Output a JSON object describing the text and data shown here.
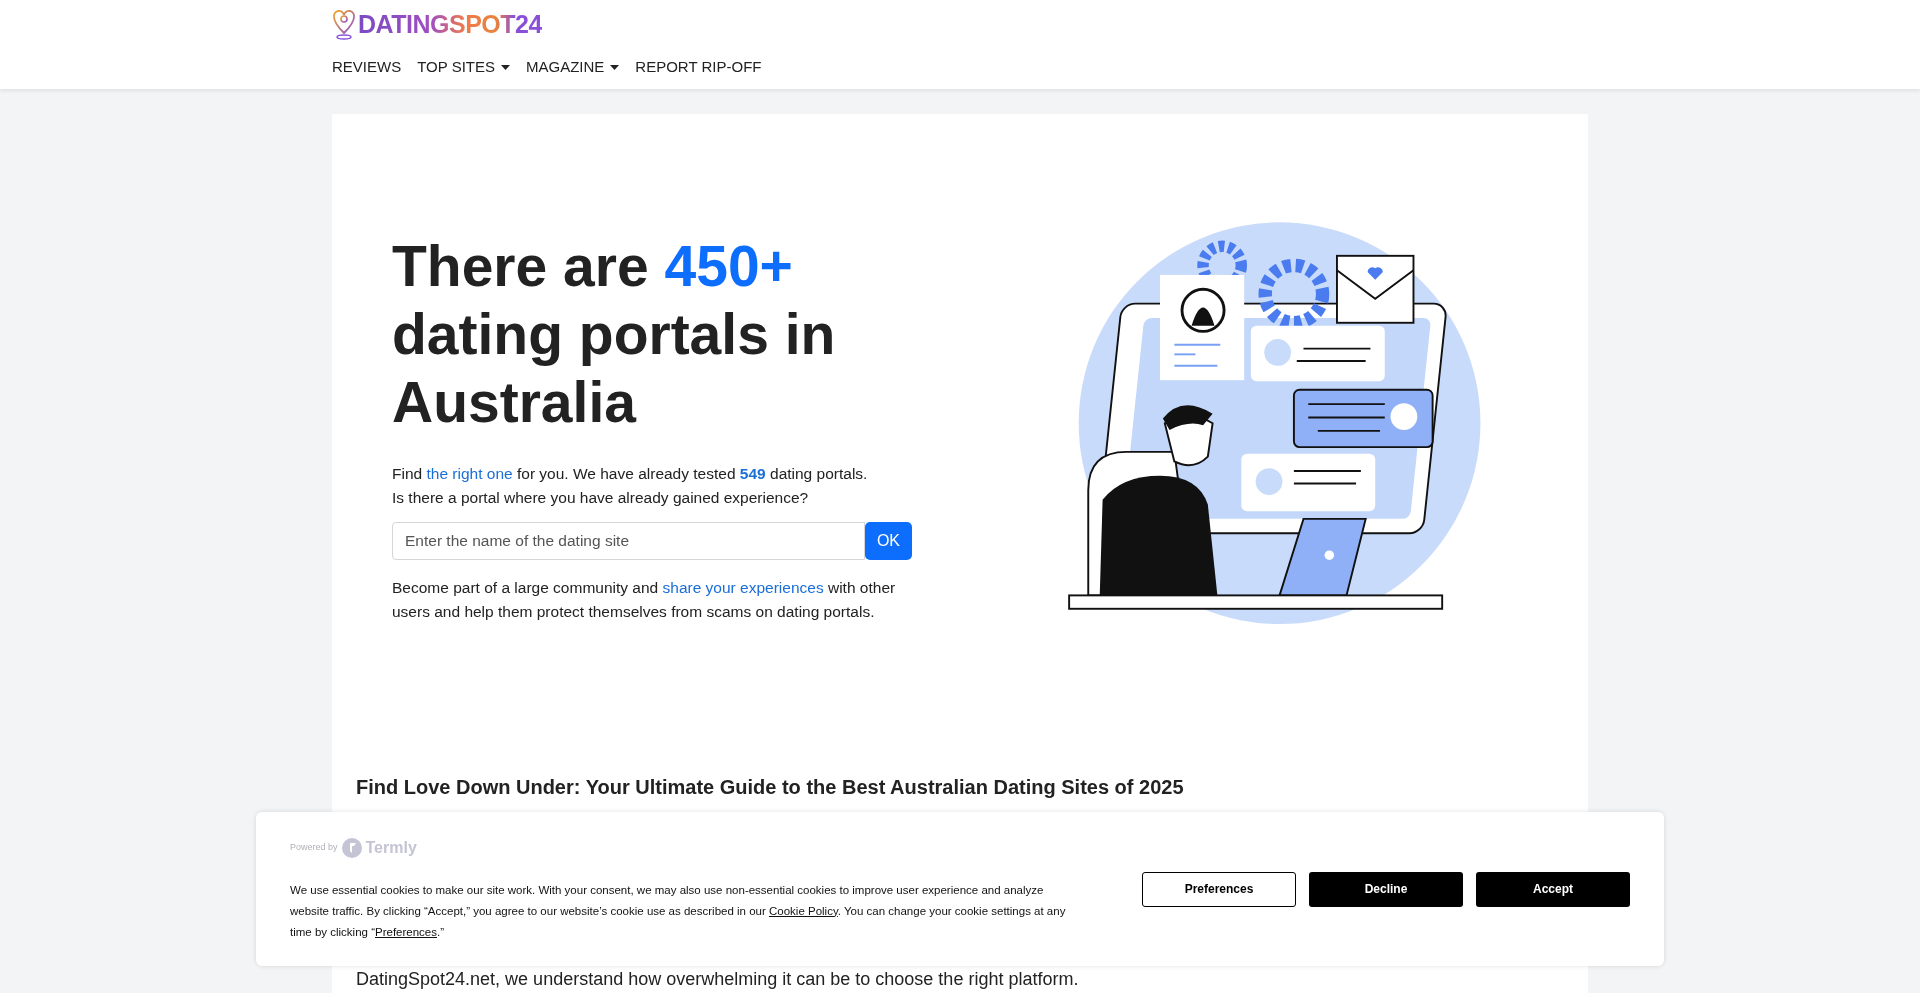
{
  "logo": {
    "text": "DATINGSPOT24"
  },
  "nav": [
    {
      "label": "REVIEWS",
      "has_dropdown": false
    },
    {
      "label": "TOP SITES",
      "has_dropdown": true
    },
    {
      "label": "MAGAZINE",
      "has_dropdown": true
    },
    {
      "label": "REPORT RIP-OFF",
      "has_dropdown": false
    }
  ],
  "hero": {
    "heading": [
      {
        "text": "There are ",
        "kind": "plain"
      },
      {
        "text": "450+",
        "kind": "highlight"
      },
      {
        "text": " dating portals in Australia",
        "kind": "plain"
      }
    ],
    "intro": [
      {
        "text": "Find ",
        "kind": "plain"
      },
      {
        "text": "the right one",
        "kind": "link"
      },
      {
        "text": " for you. We have already tested ",
        "kind": "plain"
      },
      {
        "text": "549",
        "kind": "bold"
      },
      {
        "text": " dating portals.",
        "kind": "plain"
      }
    ],
    "question": "Is there a portal where you have already gained experience?",
    "search": {
      "placeholder": "Enter the name of the dating site",
      "button": "OK"
    },
    "community": [
      {
        "text": "Become part of a large community and ",
        "kind": "plain"
      },
      {
        "text": "share your experiences",
        "kind": "link"
      },
      {
        "text": " with other users and help them protect themselves from scams on dating portals.",
        "kind": "plain"
      }
    ]
  },
  "section": {
    "heading": "Find Love Down Under: Your Ultimate Guide to the Best Australian Dating Sites of 2025",
    "text": "DatingSpot24.net, we understand how overwhelming it can be to choose the right platform."
  },
  "cookie_banner": {
    "powered_by": "Powered by",
    "brand": "Termly",
    "text": [
      {
        "text": "We use essential cookies to make our site work. With your consent, we may also use non-essential cookies to improve user experience and analyze website traffic. By clicking “Accept,” you agree to our website’s cookie use as described in our ",
        "kind": "plain"
      },
      {
        "text": "Cookie Policy",
        "kind": "link"
      },
      {
        "text": ". You can change your cookie settings at any time by clicking “",
        "kind": "plain"
      },
      {
        "text": "Preferences",
        "kind": "link"
      },
      {
        "text": ".”",
        "kind": "plain"
      }
    ],
    "buttons": [
      {
        "label": "Preferences",
        "kind": "outline"
      },
      {
        "label": "Decline",
        "kind": "solid"
      },
      {
        "label": "Accept",
        "kind": "solid"
      }
    ]
  }
}
